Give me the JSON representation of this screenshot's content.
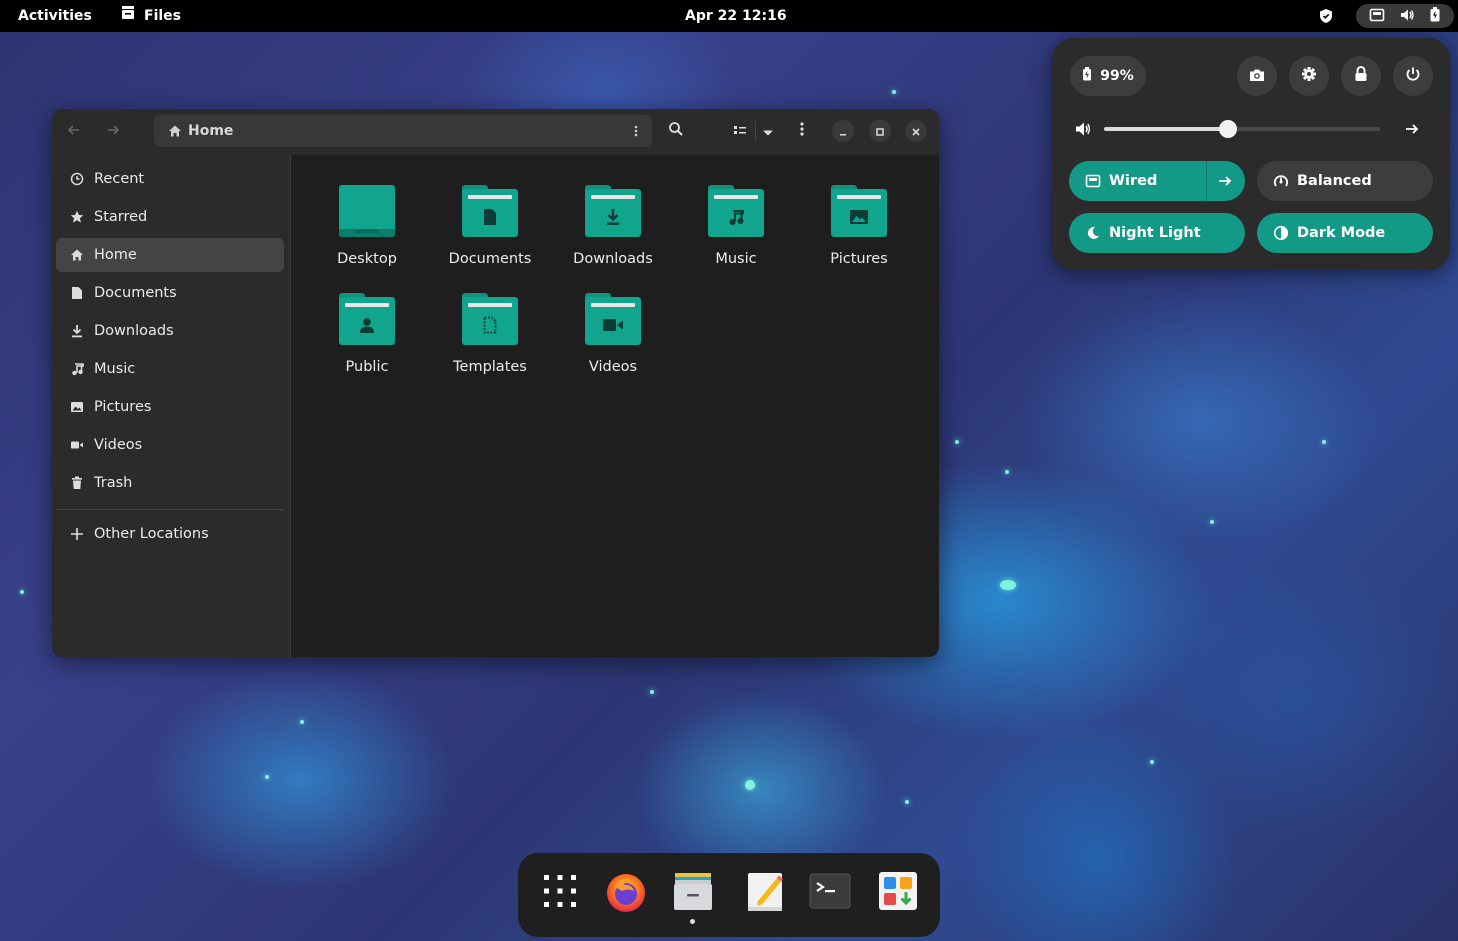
{
  "topbar": {
    "activities": "Activities",
    "app_name": "Files",
    "clock": "Apr 22  12:16"
  },
  "window": {
    "path_label": "Home",
    "sidebar": {
      "items": [
        {
          "label": "Recent",
          "icon": "clock-icon"
        },
        {
          "label": "Starred",
          "icon": "star-icon"
        },
        {
          "label": "Home",
          "icon": "home-icon",
          "active": true
        },
        {
          "label": "Documents",
          "icon": "document-icon"
        },
        {
          "label": "Downloads",
          "icon": "download-icon"
        },
        {
          "label": "Music",
          "icon": "music-icon"
        },
        {
          "label": "Pictures",
          "icon": "picture-icon"
        },
        {
          "label": "Videos",
          "icon": "video-icon"
        },
        {
          "label": "Trash",
          "icon": "trash-icon"
        }
      ],
      "other_locations": "Other Locations"
    },
    "folders": [
      {
        "name": "Desktop",
        "icon": "desktop-folder-icon"
      },
      {
        "name": "Documents",
        "icon": "documents-folder-icon"
      },
      {
        "name": "Downloads",
        "icon": "downloads-folder-icon"
      },
      {
        "name": "Music",
        "icon": "music-folder-icon"
      },
      {
        "name": "Pictures",
        "icon": "pictures-folder-icon"
      },
      {
        "name": "Public",
        "icon": "public-folder-icon"
      },
      {
        "name": "Templates",
        "icon": "templates-folder-icon"
      },
      {
        "name": "Videos",
        "icon": "videos-folder-icon"
      }
    ]
  },
  "quick_settings": {
    "battery": "99%",
    "volume_level": 0.45,
    "toggles": {
      "wired": "Wired",
      "balanced": "Balanced",
      "night_light": "Night Light",
      "dark_mode": "Dark Mode"
    }
  },
  "dock": {
    "apps": [
      "app-grid-icon",
      "firefox-icon",
      "files-icon",
      "text-editor-icon",
      "terminal-icon",
      "software-icon"
    ]
  },
  "colors": {
    "accent": "#139a86",
    "folder": "#12a58e",
    "window_bg": "#1e1e1e",
    "sidebar_bg": "#2b2b2b"
  }
}
